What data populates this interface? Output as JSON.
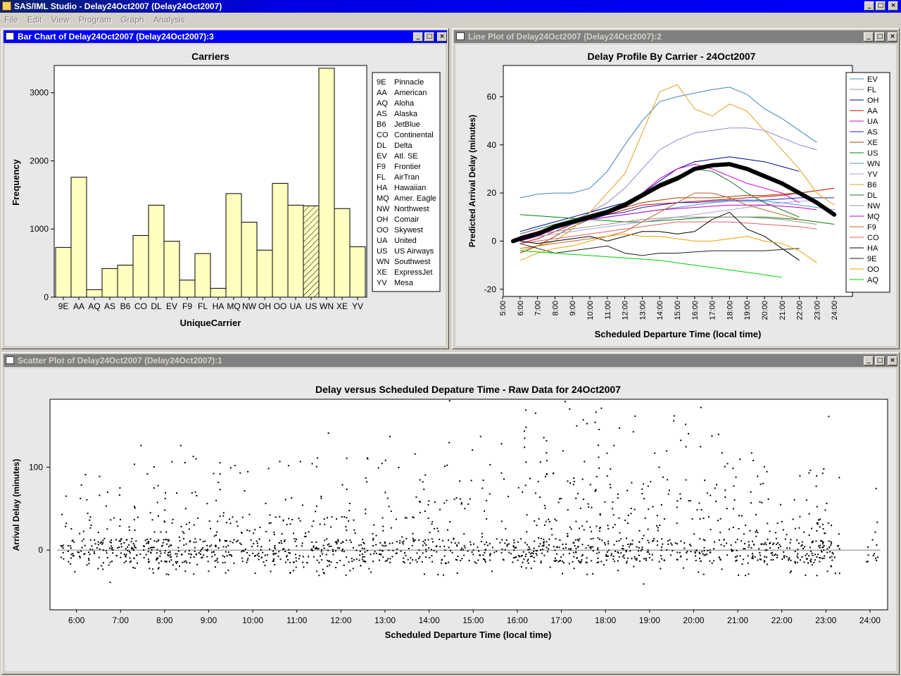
{
  "app": {
    "title": "SAS/IML Studio - Delay24Oct2007 (Delay24Oct2007)"
  },
  "menu": [
    "File",
    "Edit",
    "View",
    "Program",
    "Graph",
    "Analysis"
  ],
  "windows": {
    "bar": {
      "title": "Bar Chart of Delay24Oct2007 (Delay24Oct2007):3"
    },
    "line": {
      "title": "Line Plot of Delay24Oct2007 (Delay24Oct2007):2"
    },
    "scatter": {
      "title": "Scatter Plot of Delay24Oct2007 (Delay24Oct2007):1"
    }
  },
  "icons": {
    "minimize": "minimize-icon",
    "maximize": "maximize-icon",
    "close": "close-icon"
  },
  "chart_data": [
    {
      "type": "bar",
      "title": "Carriers",
      "xlabel": "UniqueCarrier",
      "ylabel": "Frequency",
      "ylim": [
        0,
        3400
      ],
      "yticks": [
        0,
        1000,
        2000,
        3000
      ],
      "categories": [
        "9E",
        "AA",
        "AQ",
        "AS",
        "B6",
        "CO",
        "DL",
        "EV",
        "F9",
        "FL",
        "HA",
        "MQ",
        "NW",
        "OH",
        "OO",
        "UA",
        "US",
        "WN",
        "XE",
        "YV"
      ],
      "values": [
        730,
        1760,
        110,
        420,
        470,
        905,
        1350,
        820,
        250,
        640,
        130,
        1520,
        1100,
        690,
        1670,
        1350,
        1340,
        3360,
        1300,
        740
      ],
      "highlighted": "US",
      "bar_color": "#ffffc0",
      "legend": [
        {
          "code": "9E",
          "name": "Pinnacle"
        },
        {
          "code": "AA",
          "name": "American"
        },
        {
          "code": "AQ",
          "name": "Aloha"
        },
        {
          "code": "AS",
          "name": "Alaska"
        },
        {
          "code": "B6",
          "name": "JetBlue"
        },
        {
          "code": "CO",
          "name": "Continental"
        },
        {
          "code": "DL",
          "name": "Delta"
        },
        {
          "code": "EV",
          "name": "Atl. SE"
        },
        {
          "code": "F9",
          "name": "Frontier"
        },
        {
          "code": "FL",
          "name": "AirTran"
        },
        {
          "code": "HA",
          "name": "Hawaiian"
        },
        {
          "code": "MQ",
          "name": "Amer. Eagle"
        },
        {
          "code": "NW",
          "name": "Northwest"
        },
        {
          "code": "OH",
          "name": "Comair"
        },
        {
          "code": "OO",
          "name": "Skywest"
        },
        {
          "code": "UA",
          "name": "United"
        },
        {
          "code": "US",
          "name": "US Airways"
        },
        {
          "code": "WN",
          "name": "Southwest"
        },
        {
          "code": "XE",
          "name": "ExpressJet"
        },
        {
          "code": "YV",
          "name": "Mesa"
        }
      ]
    },
    {
      "type": "line",
      "title": "Delay Profile By Carrier - 24Oct2007",
      "xlabel": "Scheduled Departure Time (local time)",
      "ylabel": "Predicted Arrival Delay (minutes)",
      "xlim": [
        5,
        25
      ],
      "ylim": [
        -23,
        73
      ],
      "yticks": [
        -20,
        0,
        20,
        40,
        60
      ],
      "xticks": [
        "5:00",
        "6:00",
        "7:00",
        "8:00",
        "9:00",
        "10:00",
        "11:00",
        "12:00",
        "13:00",
        "14:00",
        "15:00",
        "16:00",
        "17:00",
        "18:00",
        "19:00",
        "20:00",
        "21:00",
        "22:00",
        "23:00",
        "24:00"
      ],
      "x": [
        6,
        7,
        8,
        9,
        10,
        11,
        12,
        13,
        14,
        15,
        16,
        17,
        18,
        19,
        20,
        21,
        22,
        23,
        24
      ],
      "series": [
        {
          "name": "EV",
          "color": "#4682b4",
          "values": [
            18,
            19.5,
            20,
            20,
            22,
            29,
            40,
            50,
            58,
            60,
            61.5,
            63,
            64,
            61,
            55,
            51,
            46,
            41,
            null
          ]
        },
        {
          "name": "FL",
          "color": "#a080d0",
          "values": [
            2,
            3,
            5,
            8,
            12,
            16,
            22,
            30,
            38,
            42,
            45,
            46,
            47,
            47,
            46,
            43,
            40,
            38,
            null
          ]
        },
        {
          "name": "OH",
          "color": "#0000a0",
          "values": [
            4,
            6,
            8,
            10,
            12,
            14,
            16,
            20,
            25,
            30,
            33,
            34,
            35,
            34,
            33,
            31,
            29,
            null,
            null
          ]
        },
        {
          "name": "AA",
          "color": "#d00000",
          "values": [
            -1,
            1,
            4,
            7,
            9,
            11,
            13,
            15,
            15.5,
            16,
            16.5,
            17,
            17.5,
            18,
            18.5,
            19,
            20,
            21,
            22
          ]
        },
        {
          "name": "UA",
          "color": "#d000d0",
          "values": [
            0,
            2,
            5,
            8,
            10,
            12,
            15,
            20,
            26,
            30,
            32,
            30,
            27,
            24,
            22,
            20,
            16,
            null,
            null
          ]
        },
        {
          "name": "AS",
          "color": "#2020c0",
          "values": [
            1,
            3,
            5,
            7,
            9,
            11,
            12,
            14,
            15,
            16,
            16,
            16.5,
            17,
            17,
            17,
            17.5,
            18,
            18,
            18
          ]
        },
        {
          "name": "XE",
          "color": "#a04000",
          "values": [
            -5,
            -2,
            2,
            6,
            9,
            12,
            14,
            16,
            17,
            18,
            18,
            18,
            18.5,
            19,
            19,
            19.5,
            20,
            21,
            null
          ]
        },
        {
          "name": "US",
          "color": "#008000",
          "values": [
            11,
            10.5,
            10,
            9.5,
            9,
            8.5,
            8,
            8,
            8.5,
            9,
            9.5,
            10,
            10,
            10,
            10,
            9.5,
            9,
            8,
            7
          ]
        },
        {
          "name": "WN",
          "color": "#5090d0",
          "values": [
            1,
            3,
            5,
            7,
            9,
            10,
            11,
            12,
            13,
            14,
            15,
            16,
            16.5,
            16.5,
            16.5,
            16,
            15,
            14,
            13
          ]
        },
        {
          "name": "YV",
          "color": "#b0a0e0",
          "values": [
            1,
            2,
            3,
            4,
            5,
            6,
            7,
            8,
            9,
            10,
            11,
            12,
            13,
            14,
            15,
            16,
            16.5,
            17,
            null
          ]
        },
        {
          "name": "B6",
          "color": "#e0a020",
          "values": [
            -4,
            -2,
            0,
            5,
            12,
            20,
            28,
            45,
            62,
            65,
            55,
            52,
            57,
            54,
            46,
            38,
            30,
            20,
            15
          ]
        },
        {
          "name": "DL",
          "color": "#207020",
          "values": [
            3,
            5,
            7,
            9,
            11,
            13,
            16,
            20,
            24,
            27,
            30,
            29,
            25,
            20,
            16,
            13,
            10,
            null,
            null
          ]
        },
        {
          "name": "NW",
          "color": "#a09090",
          "values": [
            2,
            3,
            4,
            5,
            6,
            7,
            8,
            9,
            9.5,
            10,
            10,
            10,
            10,
            10,
            9.5,
            9,
            8,
            7,
            null
          ]
        },
        {
          "name": "MQ",
          "color": "#c000c0",
          "values": [
            2,
            4,
            6,
            8,
            9,
            10,
            11,
            12,
            13,
            13.5,
            14,
            14.5,
            15,
            15,
            15,
            14.5,
            14,
            13,
            null
          ]
        },
        {
          "name": "F9",
          "color": "#c06020",
          "values": [
            -3,
            -2,
            -1,
            0,
            1,
            2,
            4,
            8,
            12,
            16,
            20,
            20,
            18,
            15,
            13,
            11,
            9,
            null,
            null
          ]
        },
        {
          "name": "CO",
          "color": "#e06060",
          "values": [
            -1,
            0,
            1,
            2,
            3,
            4,
            5,
            6,
            7,
            8,
            8,
            8,
            8,
            7.5,
            7,
            6.5,
            6,
            5,
            null
          ]
        },
        {
          "name": "HA",
          "color": "#000000",
          "values": [
            0,
            -1,
            0,
            1,
            2,
            0,
            2,
            4,
            4,
            3,
            4,
            9,
            12,
            5,
            2,
            -3,
            -8,
            null,
            null
          ]
        },
        {
          "name": "9E",
          "color": "#202020",
          "values": [
            -1,
            -3,
            -5,
            -4,
            -3,
            -2,
            -5,
            -6,
            -5,
            -5,
            -4.5,
            -4,
            -4,
            -4,
            -4,
            -3.5,
            -3,
            null,
            null
          ]
        },
        {
          "name": "OO",
          "color": "#f0a000",
          "values": [
            -8,
            -5,
            -3,
            -2,
            0,
            2,
            3,
            2,
            2,
            1,
            0,
            0,
            1,
            2,
            0,
            -1,
            -4,
            -9,
            null
          ]
        },
        {
          "name": "AQ",
          "color": "#00d000",
          "values": [
            -4,
            -4.5,
            -5,
            -5.5,
            -6,
            -6.5,
            -7,
            -7.5,
            -8,
            -9,
            -10,
            -11,
            -12,
            -13,
            -14,
            -15,
            null,
            null,
            null
          ]
        }
      ],
      "fit": {
        "x": [
          5.6,
          6,
          7,
          8,
          9,
          10,
          11,
          12,
          13,
          14,
          15,
          16,
          17,
          18,
          19,
          20,
          21,
          22,
          23,
          24
        ],
        "values": [
          0,
          1,
          3,
          6,
          8,
          10,
          12,
          15,
          19,
          23,
          26,
          30,
          31.5,
          32,
          30,
          27,
          24,
          20,
          16,
          11
        ]
      }
    },
    {
      "type": "scatter",
      "title": "Delay versus Scheduled Depature Time - Raw Data for 24Oct2007",
      "xlabel": "Scheduled Departure Time (local time)",
      "ylabel": "Arrival Delay (minutes)",
      "xlim": [
        5.4,
        24.4
      ],
      "ylim": [
        -72,
        182
      ],
      "yticks": [
        0,
        100
      ],
      "xticks": [
        "6:00",
        "7:00",
        "8:00",
        "9:00",
        "10:00",
        "11:00",
        "12:00",
        "13:00",
        "14:00",
        "15:00",
        "16:00",
        "17:00",
        "18:00",
        "19:00",
        "20:00",
        "21:00",
        "22:00",
        "23:00",
        "24:00"
      ],
      "notable_points": [
        {
          "x": 14.45,
          "y": 181
        },
        {
          "x": 17.07,
          "y": 180
        },
        {
          "x": 17.75,
          "y": 155
        },
        {
          "x": 15.15,
          "y": 138
        },
        {
          "x": 16.4,
          "y": 166
        },
        {
          "x": 20.15,
          "y": 173
        },
        {
          "x": 23.05,
          "y": 162
        },
        {
          "x": 11.7,
          "y": 142
        },
        {
          "x": 5.75,
          "y": 66
        },
        {
          "x": 7.45,
          "y": 127
        },
        {
          "x": 8.35,
          "y": 127
        },
        {
          "x": 11.45,
          "y": 112
        },
        {
          "x": 18.3,
          "y": 148
        },
        {
          "x": 21.3,
          "y": 118
        },
        {
          "x": 6.75,
          "y": -38
        },
        {
          "x": 18.85,
          "y": -40
        }
      ]
    }
  ]
}
